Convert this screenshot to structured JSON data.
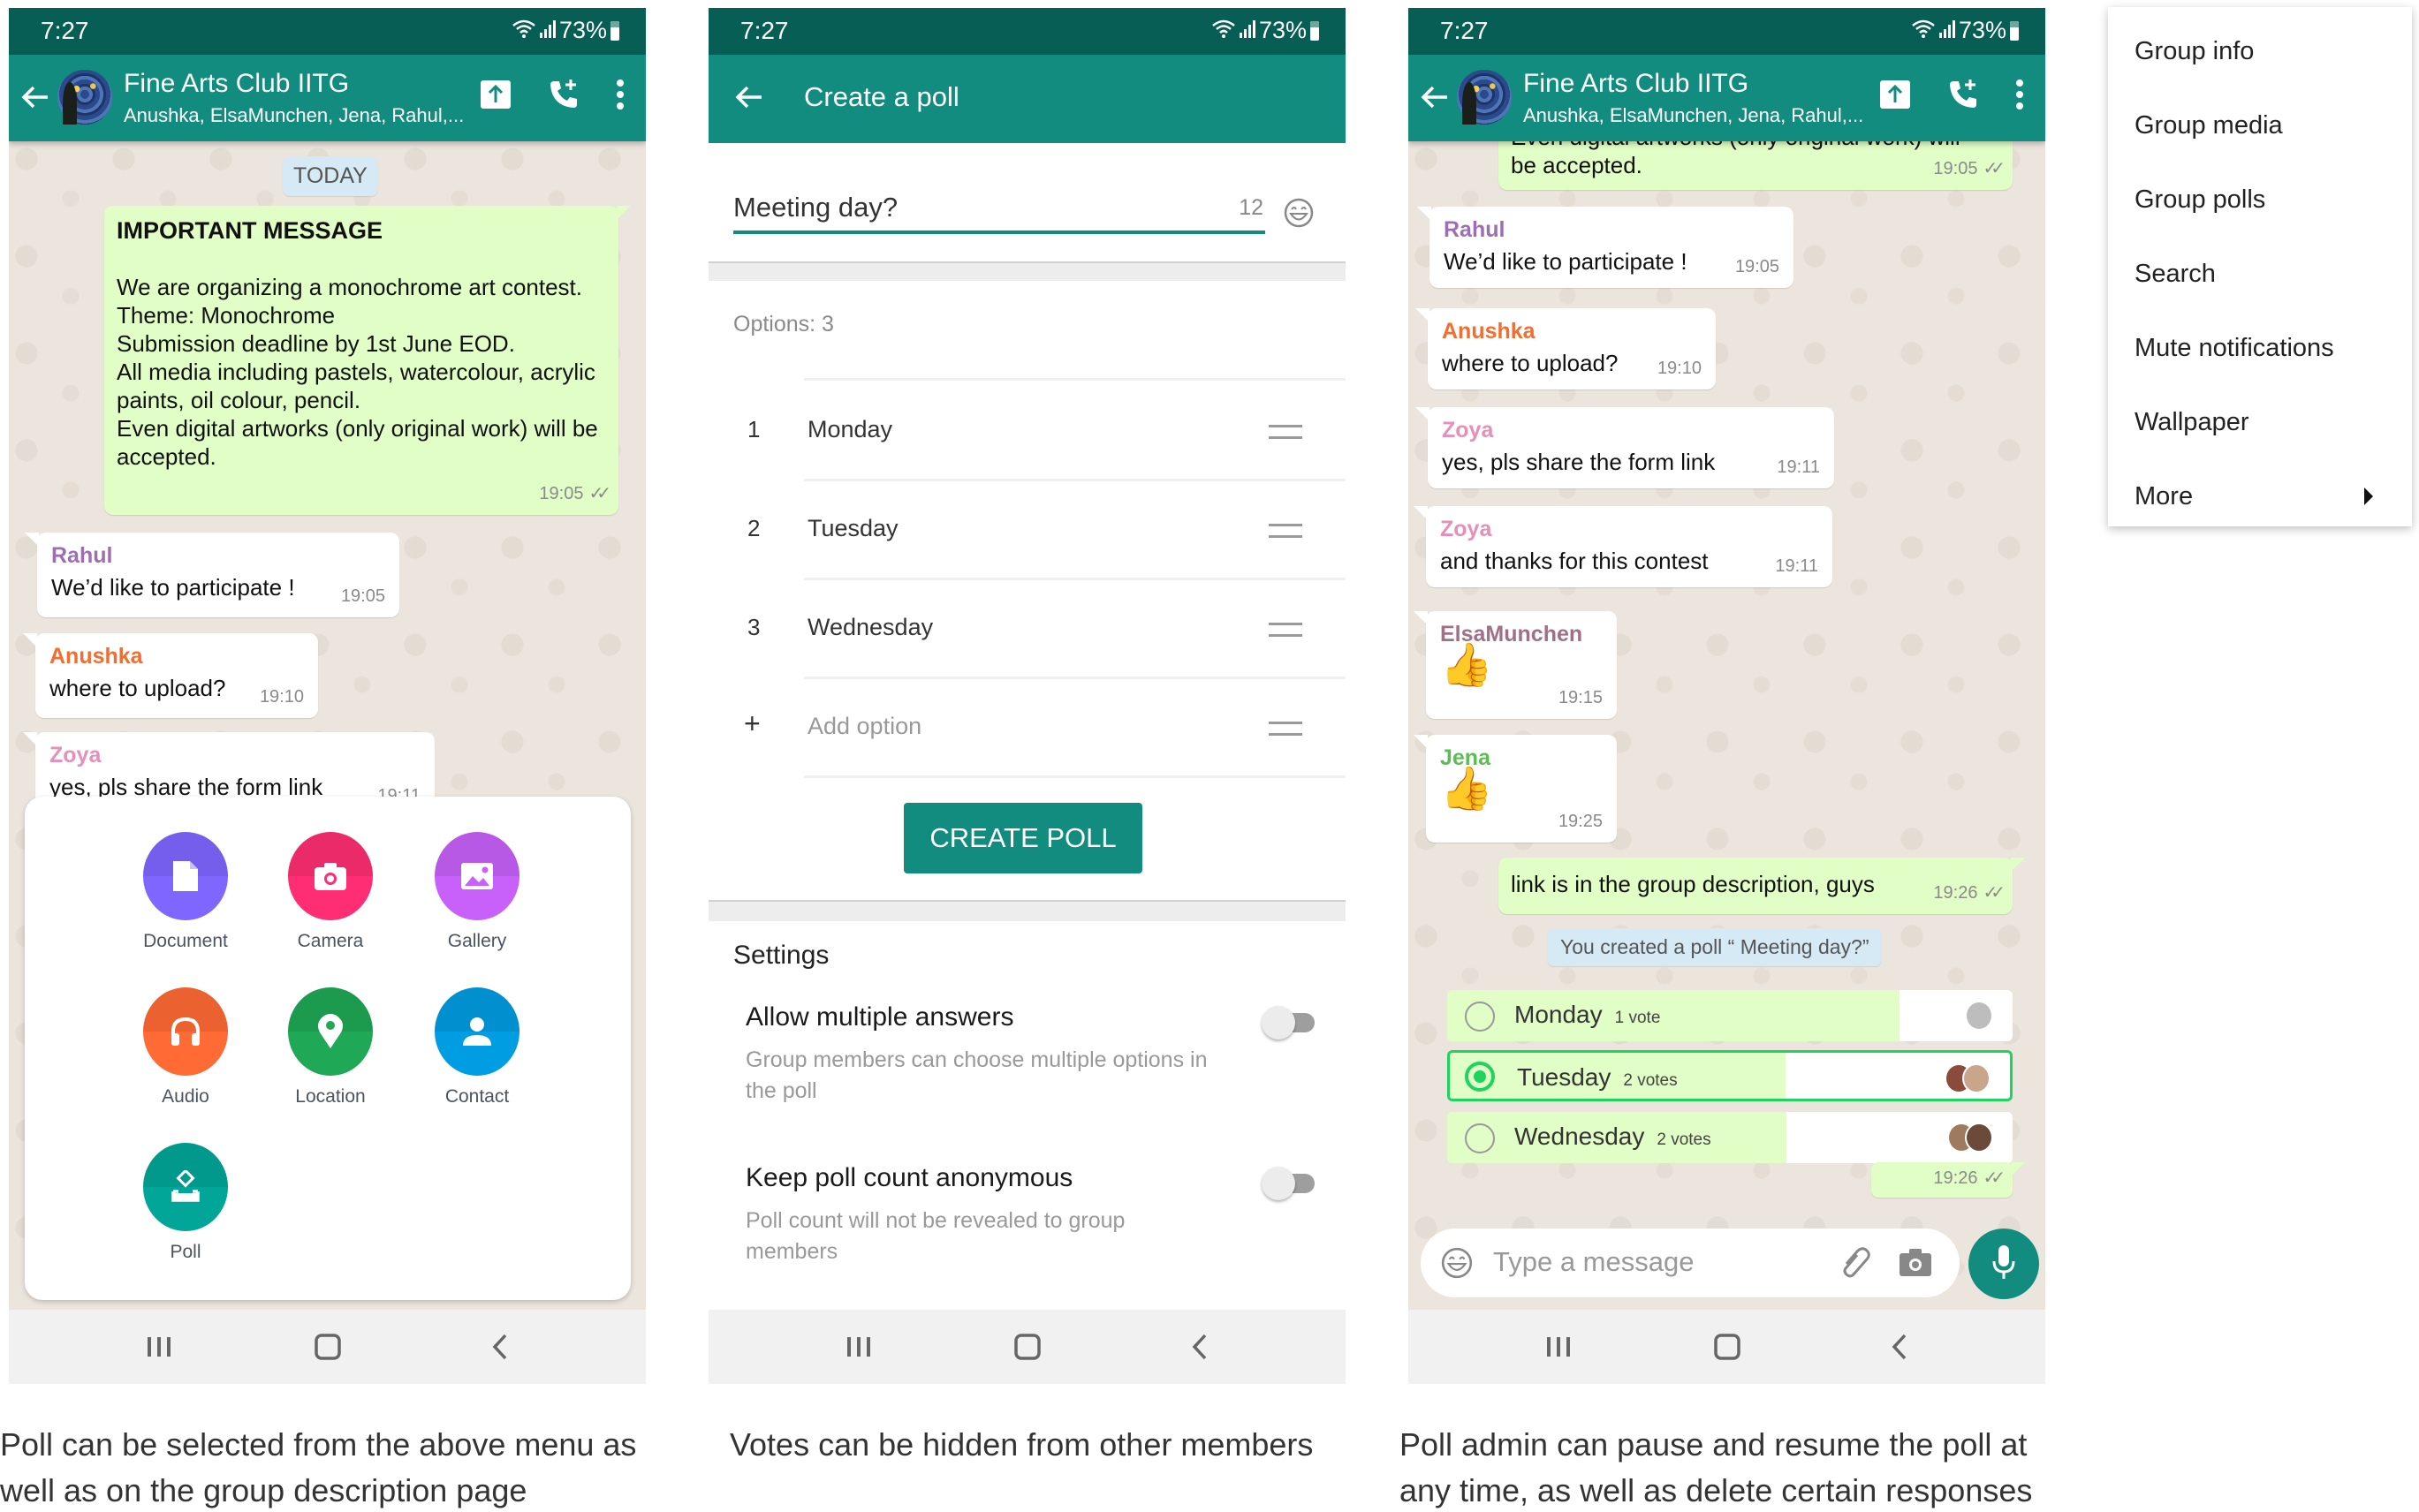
{
  "status_bar": {
    "time": "7:27",
    "battery": "73%"
  },
  "chat": {
    "group_name": "Fine Arts Club IITG",
    "members": "Anushka, ElsaMunchen, Jena, Rahul,...",
    "date_chip": "TODAY",
    "announcement": {
      "heading": "IMPORTANT MESSAGE",
      "lines": [
        "We are organizing a monochrome art contest.",
        "Theme: Monochrome",
        "Submission deadline by 1st June EOD.",
        "All media including pastels, watercolour, acrylic paints, oil colour, pencil.",
        "Even digital artworks (only original work) will be accepted."
      ],
      "tail_line": "Even digital artworks (only original work) will",
      "tail_line2": "be accepted.",
      "time": "19:05"
    },
    "messages": [
      {
        "sender": "Rahul",
        "color": "#9c6fb0",
        "text": "We’d like to participate !",
        "time": "19:05"
      },
      {
        "sender": "Anushka",
        "color": "#f26d30",
        "text": "where to upload?",
        "time": "19:10"
      },
      {
        "sender": "Zoya",
        "color": "#e68fb8",
        "text": "yes, pls share the form link",
        "time": "19:11"
      },
      {
        "sender": "Zoya",
        "color": "#e68fb8",
        "text": "and thanks for this contest",
        "time": "19:11"
      },
      {
        "sender": "ElsaMunchen",
        "color": "#a06f88",
        "text": "👍",
        "time": "19:15"
      },
      {
        "sender": "Jena",
        "color": "#5cbd55",
        "text": "👍",
        "time": "19:25"
      }
    ],
    "outgoing_link": {
      "text": "link is in the group description, guys",
      "time": "19:26"
    },
    "system_note": "You created a poll “ Meeting day?”",
    "poll_time": "19:26",
    "input_placeholder": "Type a message"
  },
  "attach_menu": {
    "items": [
      {
        "label": "Document",
        "icon": "document-icon",
        "color": "#7f66ff"
      },
      {
        "label": "Camera",
        "icon": "camera-icon",
        "color": "#ff2e74"
      },
      {
        "label": "Gallery",
        "icon": "gallery-icon",
        "color": "#c861fa"
      },
      {
        "label": "Audio",
        "icon": "headphones-icon",
        "color": "#ff6a35"
      },
      {
        "label": "Location",
        "icon": "location-pin-icon",
        "color": "#1fa855"
      },
      {
        "label": "Contact",
        "icon": "contact-icon",
        "color": "#009de2"
      },
      {
        "label": "Poll",
        "icon": "poll-icon",
        "color": "#02a698"
      }
    ]
  },
  "create_poll": {
    "title": "Create a poll",
    "question": "Meeting day?",
    "char_count": "12",
    "options_label": "Options: 3",
    "options": [
      {
        "num": "1",
        "text": "Monday"
      },
      {
        "num": "2",
        "text": "Tuesday"
      },
      {
        "num": "3",
        "text": "Wednesday"
      }
    ],
    "add_option_placeholder": "Add option",
    "create_button": "CREATE POLL",
    "settings_title": "Settings",
    "settings": [
      {
        "title": "Allow multiple answers",
        "desc": "Group members can choose multiple options in the poll",
        "enabled": false
      },
      {
        "title": "Keep poll count anonymous",
        "desc": "Poll count will not be revealed to group members",
        "enabled": false
      }
    ]
  },
  "poll_result": {
    "options": [
      {
        "name": "Monday",
        "votes_label": "1 vote",
        "votes": 1,
        "share": 0.8,
        "selected": false
      },
      {
        "name": "Tuesday",
        "votes_label": "2 votes",
        "votes": 2,
        "share": 0.6,
        "selected": true
      },
      {
        "name": "Wednesday",
        "votes_label": "2 votes",
        "votes": 2,
        "share": 0.6,
        "selected": false
      }
    ]
  },
  "overflow_menu": {
    "items": [
      "Group info",
      "Group media",
      "Group polls",
      "Search",
      "Mute notifications",
      "Wallpaper",
      "More"
    ]
  },
  "captions": [
    "Poll can be selected from the above menu as well as on the group description page",
    "Votes can be hidden from other members",
    "Poll admin can pause and resume the poll at any time, as well as delete certain responses"
  ],
  "colors": {
    "header_dark": "#075e54",
    "header": "#128c7e",
    "outgoing_bubble": "#e1fec6",
    "poll_selected": "#1ed45e"
  }
}
